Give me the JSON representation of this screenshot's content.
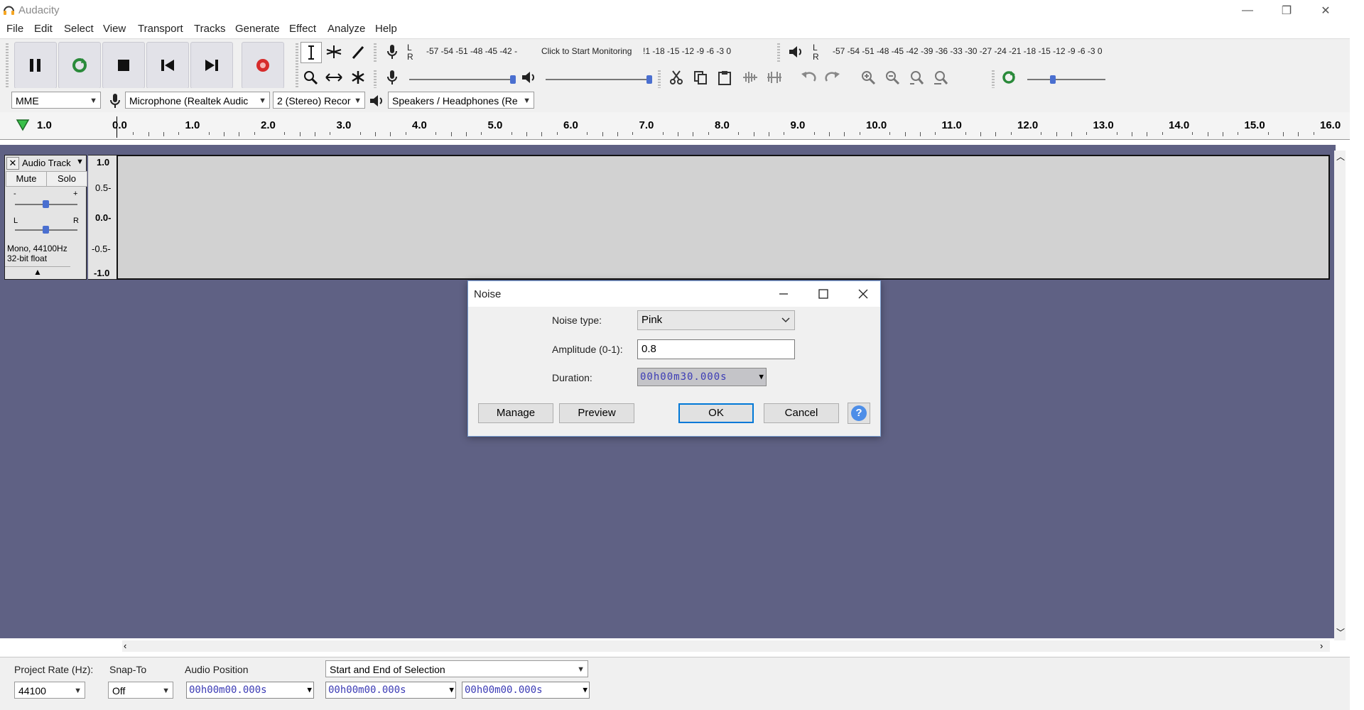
{
  "window": {
    "title": "Audacity",
    "minimize": "—",
    "restore": "❐",
    "close": "✕"
  },
  "menu": [
    "File",
    "Edit",
    "Select",
    "View",
    "Transport",
    "Tracks",
    "Generate",
    "Effect",
    "Analyze",
    "Help"
  ],
  "meters": {
    "rec_scale": "-57 -54 -51 -48 -45 -42 -",
    "rec_prompt": "Click to Start Monitoring",
    "rec_scale_right": "!1 -18 -15 -12  -9  -6  -3  0",
    "play_scale": "-57 -54 -51 -48 -45 -42 -39 -36 -33 -30 -27 -24 -21 -18 -15 -12  -9  -6  -3  0",
    "L": "L",
    "R": "R"
  },
  "device": {
    "host": "MME",
    "mic": "Microphone (Realtek Audic",
    "channels": "2 (Stereo) Recor",
    "speakers": "Speakers / Headphones (Re"
  },
  "ruler": {
    "start": "1.0",
    "ticks": [
      "0.0",
      "1.0",
      "2.0",
      "3.0",
      "4.0",
      "5.0",
      "6.0",
      "7.0",
      "8.0",
      "9.0",
      "10.0",
      "11.0",
      "12.0",
      "13.0",
      "14.0",
      "15.0",
      "16.0"
    ]
  },
  "track": {
    "name": "Audio Track",
    "mute": "Mute",
    "solo": "Solo",
    "gain_minus": "-",
    "gain_plus": "+",
    "pan_l": "L",
    "pan_r": "R",
    "info_line1": "Mono, 44100Hz",
    "info_line2": "32-bit float",
    "scale": [
      "1.0",
      "0.5-",
      "0.0-",
      "-0.5-",
      "-1.0"
    ]
  },
  "dialog": {
    "title": "Noise",
    "noise_type_label": "Noise type:",
    "noise_type_value": "Pink",
    "amplitude_label": "Amplitude (0-1):",
    "amplitude_value": "0.8",
    "duration_label": "Duration:",
    "duration_value": "00h00m30.000s",
    "manage": "Manage",
    "preview": "Preview",
    "ok": "OK",
    "cancel": "Cancel",
    "help": "?"
  },
  "status": {
    "project_rate_label": "Project Rate (Hz):",
    "project_rate_value": "44100",
    "snap_label": "Snap-To",
    "snap_value": "Off",
    "audio_position_label": "Audio Position",
    "audio_position_value": "00h00m00.000s",
    "selection_label": "Start and End of Selection",
    "sel_start": "00h00m00.000s",
    "sel_end": "00h00m00.000s"
  },
  "colors": {
    "track_bg": "#5f6184",
    "accent": "#0078d7",
    "time_text": "#3b3bb5",
    "record_red": "#d62b2b"
  }
}
